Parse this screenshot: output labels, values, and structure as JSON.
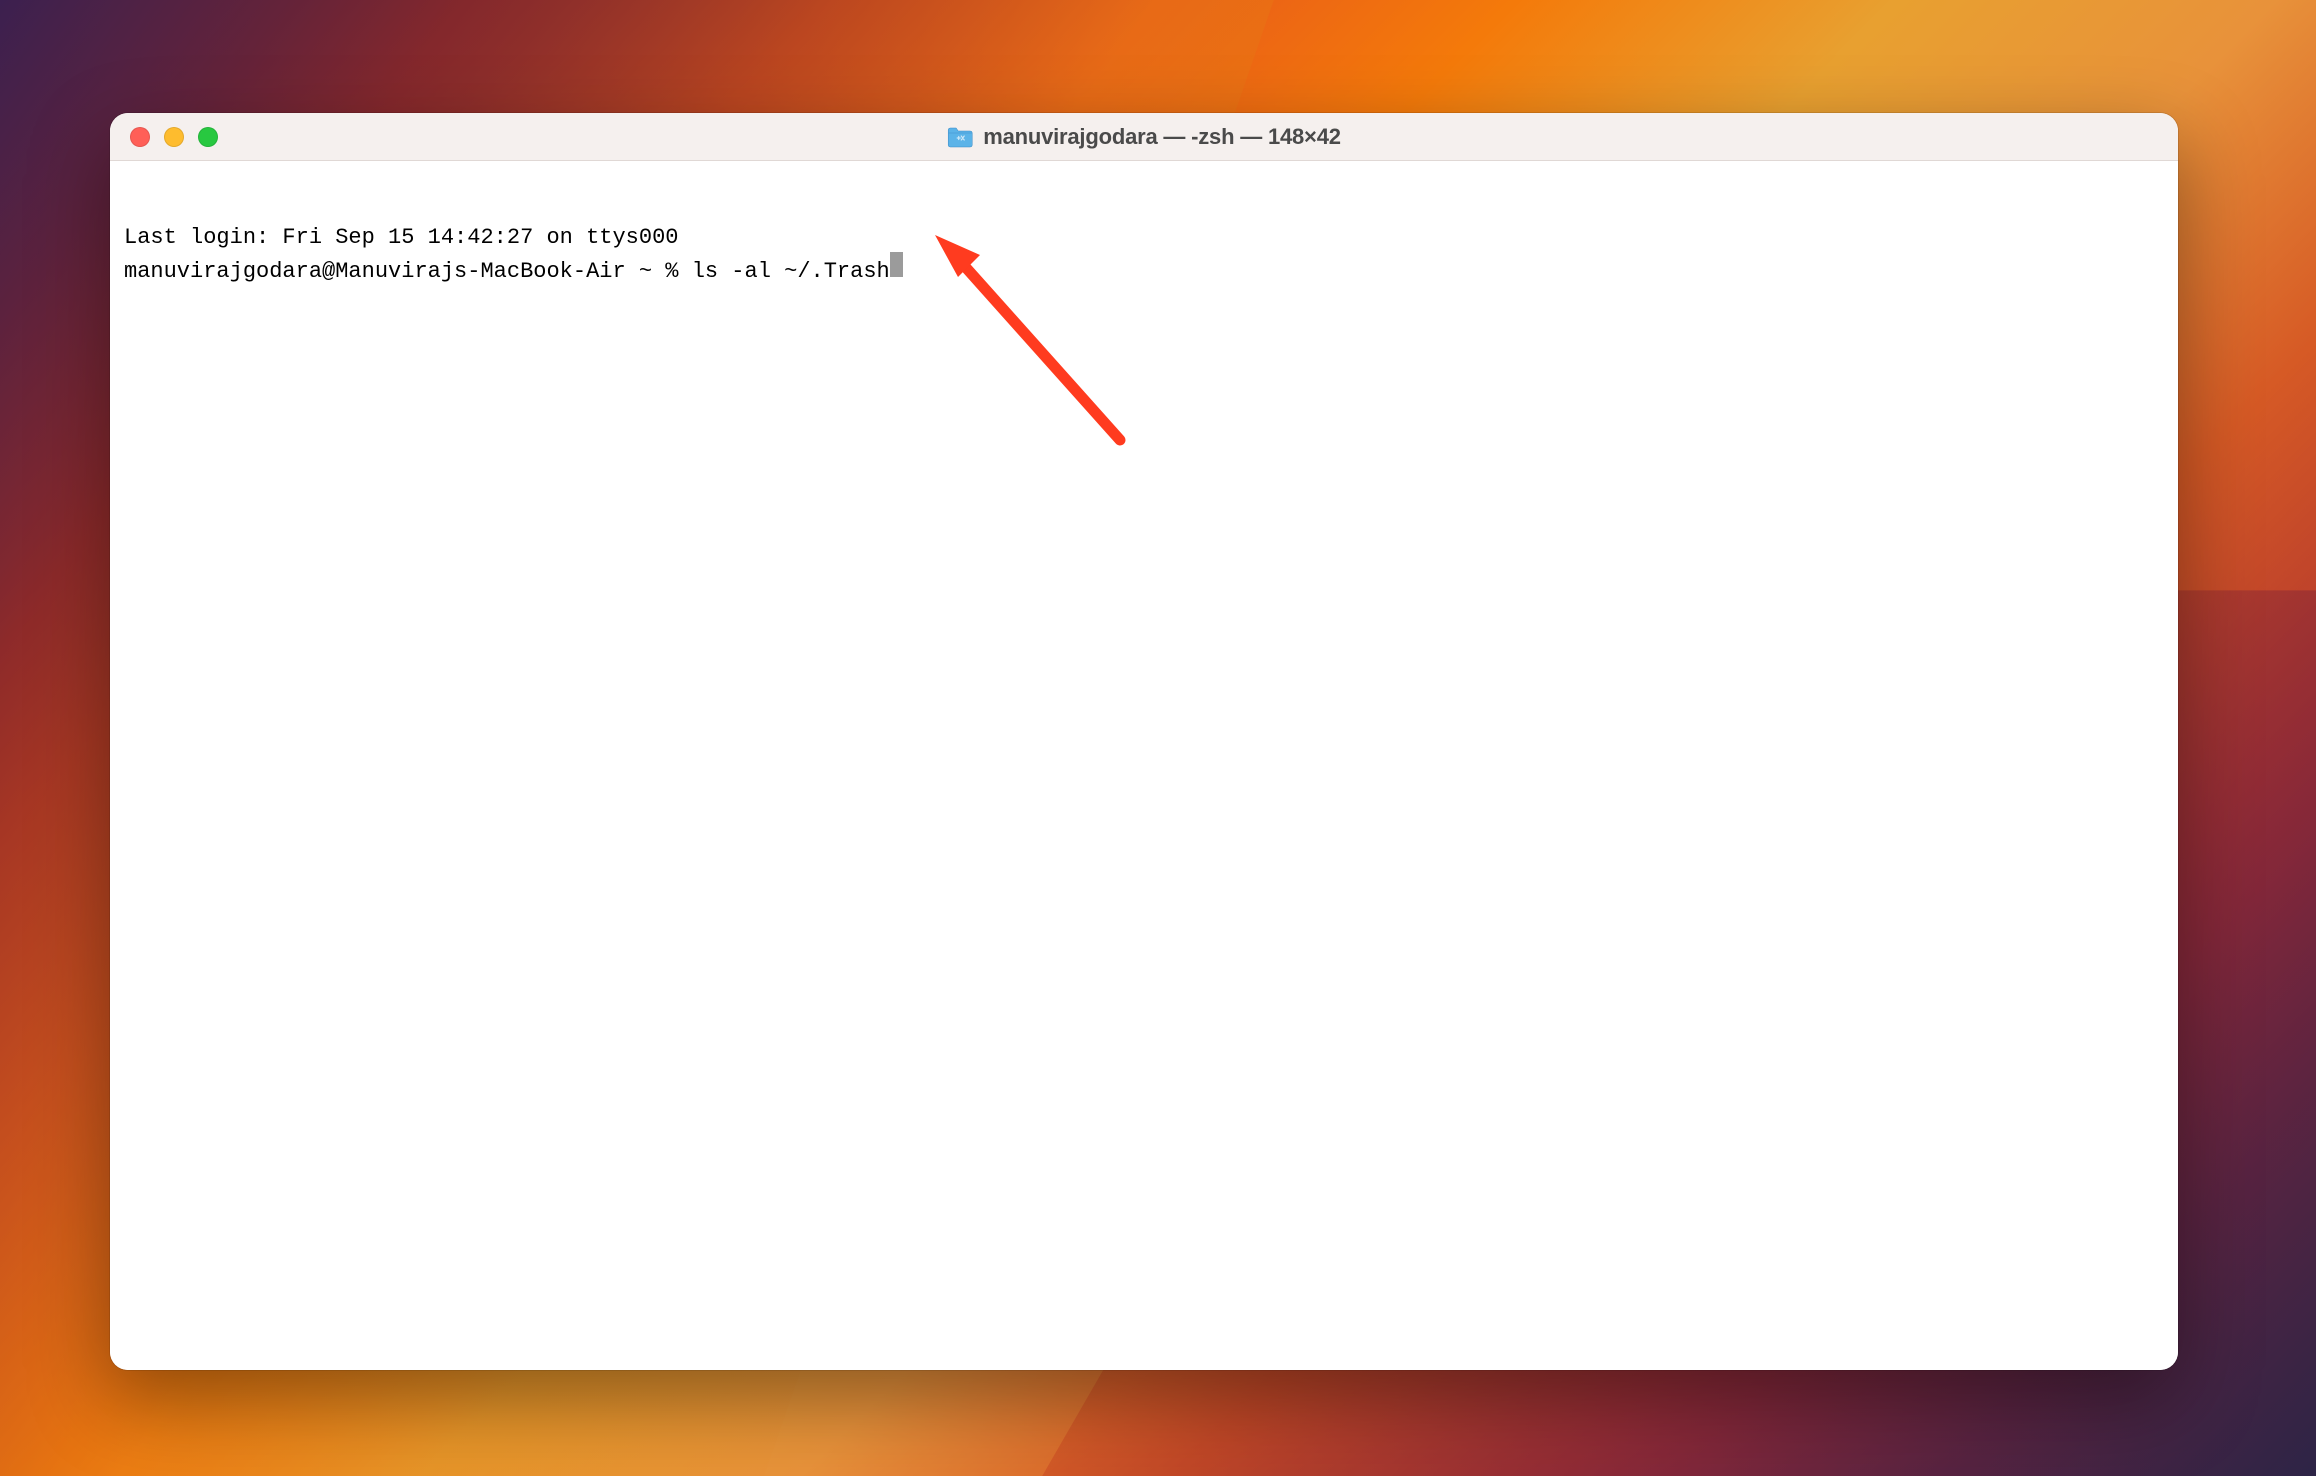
{
  "window": {
    "title": "manuvirajgodara — -zsh — 148×42"
  },
  "terminal": {
    "login_text": "Last login: Fri Sep 15 14:42:27 on ttys000",
    "prompt": "manuvirajgodara@Manuvirajs-MacBook-Air ~ % ",
    "command": "ls -al ~/.Trash"
  }
}
